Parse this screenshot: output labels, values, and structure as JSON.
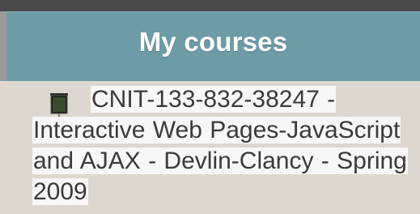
{
  "block": {
    "title": "My courses"
  },
  "courses": [
    {
      "icon": "presentation-board-icon",
      "label": "CNIT-133-832-38247 - Interactive Web Pages-JavaScript and AJAX - Devlin-Clancy - Spring 2009"
    }
  ],
  "colors": {
    "header_bg": "#6e9ca6",
    "content_bg": "#dcd8d0",
    "title_text": "#ffffff",
    "link_text": "#3a3a3a"
  }
}
